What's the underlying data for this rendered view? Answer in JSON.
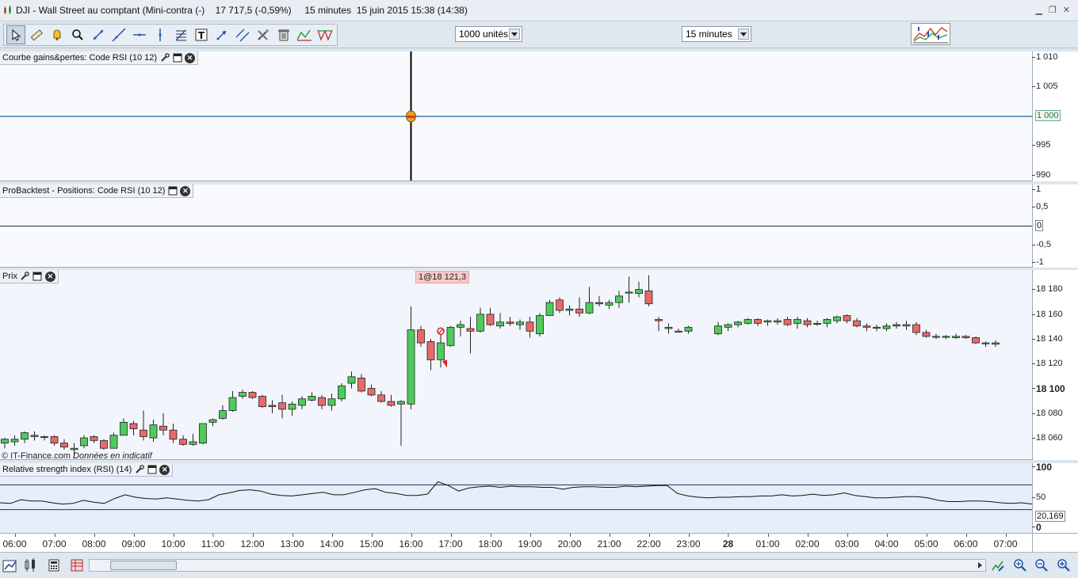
{
  "window": {
    "title": "DJI - Wall Street au comptant (Mini-contra (-)    17 717,5 (-0,59%)     15 minutes  15 juin 2015 15:38 (14:38)"
  },
  "toolbar": {
    "units_value": "1000 unités",
    "timeframe_value": "15 minutes"
  },
  "panels": {
    "equity": {
      "title": "Courbe gains&pertes: Code RSI (10 12)",
      "axis_ticks": [
        "1 010",
        "1 005",
        "995",
        "990"
      ],
      "current_badge": "1 000"
    },
    "positions": {
      "title": "ProBacktest - Positions: Code RSI (10 12)",
      "axis_ticks": [
        "1",
        "0,5",
        "-0,5",
        "-1"
      ],
      "current_badge": "0"
    },
    "price": {
      "title": "Prix",
      "trade_label": "1@18 121,3",
      "copyright": "© IT-Finance.com",
      "copyright_note": "Données en indicatif",
      "axis_ticks": [
        "18 180",
        "18 160",
        "18 140",
        "18 120",
        "18 100",
        "18 080",
        "18 060"
      ]
    },
    "rsi": {
      "title": "Relative strength index (RSI) (14)",
      "axis_ticks": [
        "100",
        "50",
        "0"
      ],
      "current_badge": "20,169"
    }
  },
  "time_axis": {
    "labels": [
      "06:00",
      "07:00",
      "08:00",
      "09:00",
      "10:00",
      "11:00",
      "12:00",
      "13:00",
      "14:00",
      "15:00",
      "16:00",
      "17:00",
      "18:00",
      "19:00",
      "20:00",
      "21:00",
      "22:00",
      "23:00",
      "28",
      "01:00",
      "02:00",
      "03:00",
      "04:00",
      "05:00",
      "06:00",
      "07:00"
    ]
  },
  "chart_data": [
    {
      "type": "line",
      "series": [
        {
          "x": [
            "16:15",
            "16:15"
          ],
          "values": [
            1000,
            1000
          ]
        }
      ],
      "ylim": [
        988,
        1012
      ]
    },
    {
      "type": "line",
      "series": [
        {
          "values": [
            0,
            0
          ]
        }
      ],
      "ylim": [
        -1.2,
        1.2
      ]
    },
    {
      "type": "candlestick",
      "ylim": [
        18047,
        18193
      ],
      "colors": {
        "up": "#4ecb5a",
        "down": "#e66a6a"
      },
      "candles": [
        {
          "o": 18060,
          "h": 18064,
          "l": 18056,
          "c": 18063
        },
        {
          "o": 18061,
          "h": 18066,
          "l": 18058,
          "c": 18063
        },
        {
          "o": 18063,
          "h": 18069,
          "l": 18060,
          "c": 18068
        },
        {
          "o": 18066,
          "h": 18069,
          "l": 18062,
          "c": 18065
        },
        {
          "o": 18065,
          "h": 18066,
          "l": 18062,
          "c": 18065
        },
        {
          "o": 18065,
          "h": 18066,
          "l": 18058,
          "c": 18060
        },
        {
          "o": 18060,
          "h": 18063,
          "l": 18055,
          "c": 18057
        },
        {
          "o": 18055,
          "h": 18060,
          "l": 18049,
          "c": 18056
        },
        {
          "o": 18058,
          "h": 18066,
          "l": 18056,
          "c": 18064
        },
        {
          "o": 18065,
          "h": 18066,
          "l": 18060,
          "c": 18062
        },
        {
          "o": 18062,
          "h": 18063,
          "l": 18055,
          "c": 18056
        },
        {
          "o": 18056,
          "h": 18068,
          "l": 18056,
          "c": 18066
        },
        {
          "o": 18066,
          "h": 18079,
          "l": 18066,
          "c": 18076
        },
        {
          "o": 18075,
          "h": 18077,
          "l": 18066,
          "c": 18071
        },
        {
          "o": 18070,
          "h": 18085,
          "l": 18062,
          "c": 18065
        },
        {
          "o": 18064,
          "h": 18078,
          "l": 18061,
          "c": 18074
        },
        {
          "o": 18073,
          "h": 18083,
          "l": 18066,
          "c": 18070
        },
        {
          "o": 18070,
          "h": 18075,
          "l": 18060,
          "c": 18063
        },
        {
          "o": 18063,
          "h": 18066,
          "l": 18058,
          "c": 18059
        },
        {
          "o": 18059,
          "h": 18067,
          "l": 18058,
          "c": 18061
        },
        {
          "o": 18060,
          "h": 18075,
          "l": 18059,
          "c": 18075
        },
        {
          "o": 18076,
          "h": 18079,
          "l": 18073,
          "c": 18078
        },
        {
          "o": 18079,
          "h": 18089,
          "l": 18078,
          "c": 18085
        },
        {
          "o": 18085,
          "h": 18100,
          "l": 18084,
          "c": 18095
        },
        {
          "o": 18096,
          "h": 18101,
          "l": 18094,
          "c": 18099
        },
        {
          "o": 18099,
          "h": 18100,
          "l": 18094,
          "c": 18095
        },
        {
          "o": 18096,
          "h": 18097,
          "l": 18087,
          "c": 18088
        },
        {
          "o": 18089,
          "h": 18093,
          "l": 18083,
          "c": 18088
        },
        {
          "o": 18091,
          "h": 18097,
          "l": 18079,
          "c": 18086
        },
        {
          "o": 18086,
          "h": 18092,
          "l": 18081,
          "c": 18090
        },
        {
          "o": 18089,
          "h": 18096,
          "l": 18086,
          "c": 18094
        },
        {
          "o": 18093,
          "h": 18099,
          "l": 18092,
          "c": 18096
        },
        {
          "o": 18095,
          "h": 18097,
          "l": 18086,
          "c": 18089
        },
        {
          "o": 18089,
          "h": 18098,
          "l": 18085,
          "c": 18094
        },
        {
          "o": 18094,
          "h": 18106,
          "l": 18092,
          "c": 18104
        },
        {
          "o": 18106,
          "h": 18115,
          "l": 18102,
          "c": 18111
        },
        {
          "o": 18110,
          "h": 18113,
          "l": 18099,
          "c": 18100
        },
        {
          "o": 18102,
          "h": 18105,
          "l": 18096,
          "c": 18097
        },
        {
          "o": 18097,
          "h": 18100,
          "l": 18091,
          "c": 18092
        },
        {
          "o": 18092,
          "h": 18097,
          "l": 18088,
          "c": 18089
        },
        {
          "o": 18090,
          "h": 18093,
          "l": 18058,
          "c": 18092
        },
        {
          "o": 18090,
          "h": 18165,
          "l": 18086,
          "c": 18147
        },
        {
          "o": 18147,
          "h": 18150,
          "l": 18134,
          "c": 18137
        },
        {
          "o": 18138,
          "h": 18140,
          "l": 18116,
          "c": 18124
        },
        {
          "o": 18124,
          "h": 18144,
          "l": 18118,
          "c": 18137
        },
        {
          "o": 18135,
          "h": 18150,
          "l": 18134,
          "c": 18149
        },
        {
          "o": 18149,
          "h": 18154,
          "l": 18142,
          "c": 18151
        },
        {
          "o": 18148,
          "h": 18157,
          "l": 18129,
          "c": 18146
        },
        {
          "o": 18146,
          "h": 18164,
          "l": 18145,
          "c": 18159
        },
        {
          "o": 18159,
          "h": 18164,
          "l": 18150,
          "c": 18151
        },
        {
          "o": 18150,
          "h": 18160,
          "l": 18148,
          "c": 18153
        },
        {
          "o": 18153,
          "h": 18157,
          "l": 18150,
          "c": 18152
        },
        {
          "o": 18151,
          "h": 18155,
          "l": 18147,
          "c": 18153
        },
        {
          "o": 18153,
          "h": 18157,
          "l": 18141,
          "c": 18146
        },
        {
          "o": 18144,
          "h": 18160,
          "l": 18142,
          "c": 18158
        },
        {
          "o": 18158,
          "h": 18170,
          "l": 18158,
          "c": 18168
        },
        {
          "o": 18170,
          "h": 18172,
          "l": 18160,
          "c": 18162
        },
        {
          "o": 18162,
          "h": 18166,
          "l": 18158,
          "c": 18163
        },
        {
          "o": 18163,
          "h": 18172,
          "l": 18157,
          "c": 18160
        },
        {
          "o": 18160,
          "h": 18180,
          "l": 18159,
          "c": 18168
        },
        {
          "o": 18168,
          "h": 18173,
          "l": 18165,
          "c": 18167
        },
        {
          "o": 18166,
          "h": 18170,
          "l": 18163,
          "c": 18168
        },
        {
          "o": 18168,
          "h": 18177,
          "l": 18164,
          "c": 18173
        },
        {
          "o": 18176,
          "h": 18188,
          "l": 18168,
          "c": 18176
        },
        {
          "o": 18175,
          "h": 18184,
          "l": 18172,
          "c": 18178
        },
        {
          "o": 18177,
          "h": 18189,
          "l": 18165,
          "c": 18167
        },
        {
          "o": 18155,
          "h": 18157,
          "l": 18146,
          "c": 18154
        },
        {
          "o": 18148,
          "h": 18152,
          "l": 18144,
          "c": 18149
        },
        {
          "o": 18146,
          "h": 18148,
          "l": 18145,
          "c": 18146
        },
        {
          "o": 18146,
          "h": 18150,
          "l": 18144,
          "c": 18149
        },
        {
          "o": 18144,
          "h": 18153,
          "l": 18143,
          "c": 18150
        },
        {
          "o": 18149,
          "h": 18152,
          "l": 18146,
          "c": 18151
        },
        {
          "o": 18151,
          "h": 18154,
          "l": 18149,
          "c": 18153
        },
        {
          "o": 18152,
          "h": 18156,
          "l": 18151,
          "c": 18155
        },
        {
          "o": 18155,
          "h": 18156,
          "l": 18150,
          "c": 18152
        },
        {
          "o": 18153,
          "h": 18155,
          "l": 18150,
          "c": 18154
        },
        {
          "o": 18153,
          "h": 18156,
          "l": 18151,
          "c": 18154
        },
        {
          "o": 18155,
          "h": 18157,
          "l": 18150,
          "c": 18151
        },
        {
          "o": 18152,
          "h": 18157,
          "l": 18148,
          "c": 18155
        },
        {
          "o": 18154,
          "h": 18156,
          "l": 18149,
          "c": 18151
        },
        {
          "o": 18152,
          "h": 18154,
          "l": 18150,
          "c": 18152
        },
        {
          "o": 18152,
          "h": 18156,
          "l": 18149,
          "c": 18155
        },
        {
          "o": 18154,
          "h": 18158,
          "l": 18152,
          "c": 18157
        },
        {
          "o": 18158,
          "h": 18159,
          "l": 18152,
          "c": 18154
        },
        {
          "o": 18154,
          "h": 18156,
          "l": 18149,
          "c": 18150
        },
        {
          "o": 18150,
          "h": 18152,
          "l": 18146,
          "c": 18149
        },
        {
          "o": 18149,
          "h": 18151,
          "l": 18146,
          "c": 18149
        },
        {
          "o": 18148,
          "h": 18152,
          "l": 18146,
          "c": 18150
        },
        {
          "o": 18151,
          "h": 18153,
          "l": 18148,
          "c": 18150
        },
        {
          "o": 18150,
          "h": 18154,
          "l": 18147,
          "c": 18151
        },
        {
          "o": 18151,
          "h": 18153,
          "l": 18143,
          "c": 18145
        },
        {
          "o": 18145,
          "h": 18147,
          "l": 18141,
          "c": 18142
        },
        {
          "o": 18142,
          "h": 18144,
          "l": 18140,
          "c": 18142
        },
        {
          "o": 18142,
          "h": 18143,
          "l": 18140,
          "c": 18142
        },
        {
          "o": 18141,
          "h": 18144,
          "l": 18140,
          "c": 18142
        },
        {
          "o": 18142,
          "h": 18143,
          "l": 18140,
          "c": 18141
        },
        {
          "o": 18141,
          "h": 18142,
          "l": 18136,
          "c": 18137
        },
        {
          "o": 18137,
          "h": 18138,
          "l": 18134,
          "c": 18137
        },
        {
          "o": 18136,
          "h": 18139,
          "l": 18134,
          "c": 18137
        }
      ],
      "gaps_after_index": [
        65,
        69
      ]
    },
    {
      "type": "line",
      "ylim": [
        0,
        100
      ],
      "overbought": 70,
      "oversold": 30,
      "series": [
        {
          "name": "RSI",
          "values": [
            41,
            40,
            46,
            44,
            44,
            41,
            39,
            40,
            45,
            42,
            40,
            48,
            54,
            50,
            48,
            47,
            49,
            47,
            45,
            44,
            46,
            54,
            57,
            61,
            62,
            60,
            55,
            53,
            52,
            54,
            56,
            58,
            54,
            54,
            58,
            62,
            64,
            58,
            56,
            53,
            53,
            55,
            75,
            69,
            60,
            65,
            67,
            68,
            66,
            68,
            67,
            67,
            66,
            66,
            63,
            66,
            67,
            67,
            66,
            66,
            68,
            67,
            68,
            69,
            69,
            56,
            52,
            50,
            49,
            50,
            50,
            51,
            51,
            52,
            52,
            54,
            52,
            53,
            55,
            53,
            54,
            57,
            53,
            51,
            49,
            49,
            50,
            51,
            51,
            49,
            45,
            43,
            43,
            44,
            44,
            43,
            41,
            40,
            41,
            39
          ]
        }
      ]
    }
  ]
}
